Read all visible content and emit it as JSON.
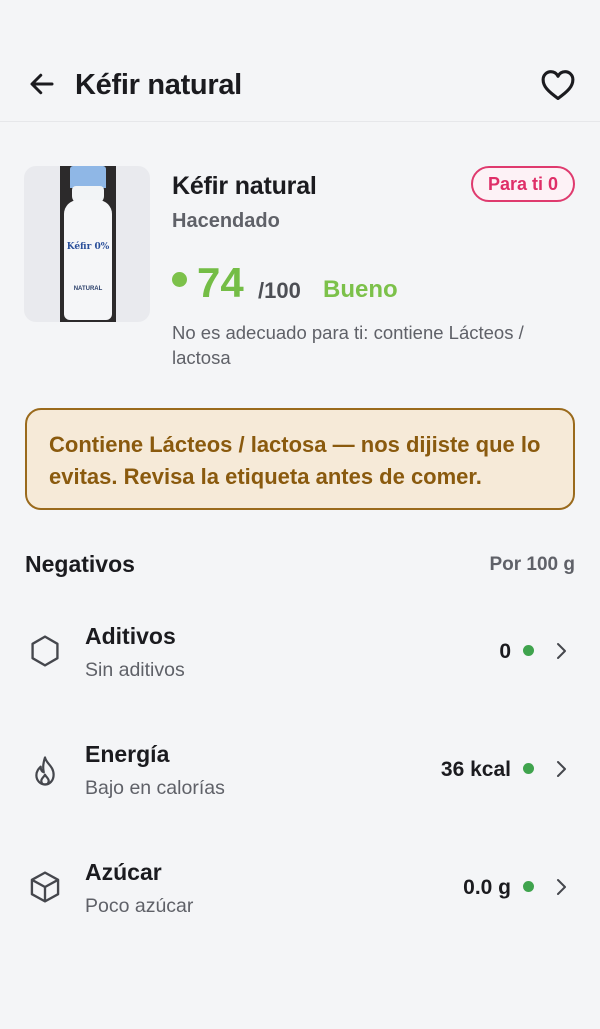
{
  "header": {
    "title": "Kéfir natural"
  },
  "icons": {
    "back": "arrow-left-icon",
    "favorite": "heart-outline-icon",
    "additives": "hexagon-icon",
    "energy": "flame-icon",
    "sugar": "cube-icon",
    "chevron": "chevron-right-icon"
  },
  "product": {
    "name": "Kéfir natural",
    "brand": "Hacendado",
    "badge": "Para ti 0",
    "score": "74",
    "score_max": "/100",
    "score_label": "Bueno",
    "notice": "No es adecuado para ti: contiene Lácteos / lactosa",
    "image_text": {
      "brand_mark": "Kéfir 0%",
      "variant": "NATURAL"
    }
  },
  "warning": {
    "text": "Contiene Lácteos / lactosa — nos dijiste que lo evitas. Revisa la etiqueta antes de comer."
  },
  "negatives": {
    "title": "Negativos",
    "per": "Por 100 g",
    "items": [
      {
        "title": "Aditivos",
        "subtitle": "Sin aditivos",
        "value": "0"
      },
      {
        "title": "Energía",
        "subtitle": "Bajo en calorías",
        "value": "36 kcal"
      },
      {
        "title": "Azúcar",
        "subtitle": "Poco azúcar",
        "value": "0.0 g"
      }
    ]
  },
  "colors": {
    "score_green": "#74bd46",
    "status_dot_green": "#3fa34d",
    "badge_pink": "#df2f68",
    "warning_brown": "#8a5a0e",
    "warning_bg": "#f6ead8"
  }
}
